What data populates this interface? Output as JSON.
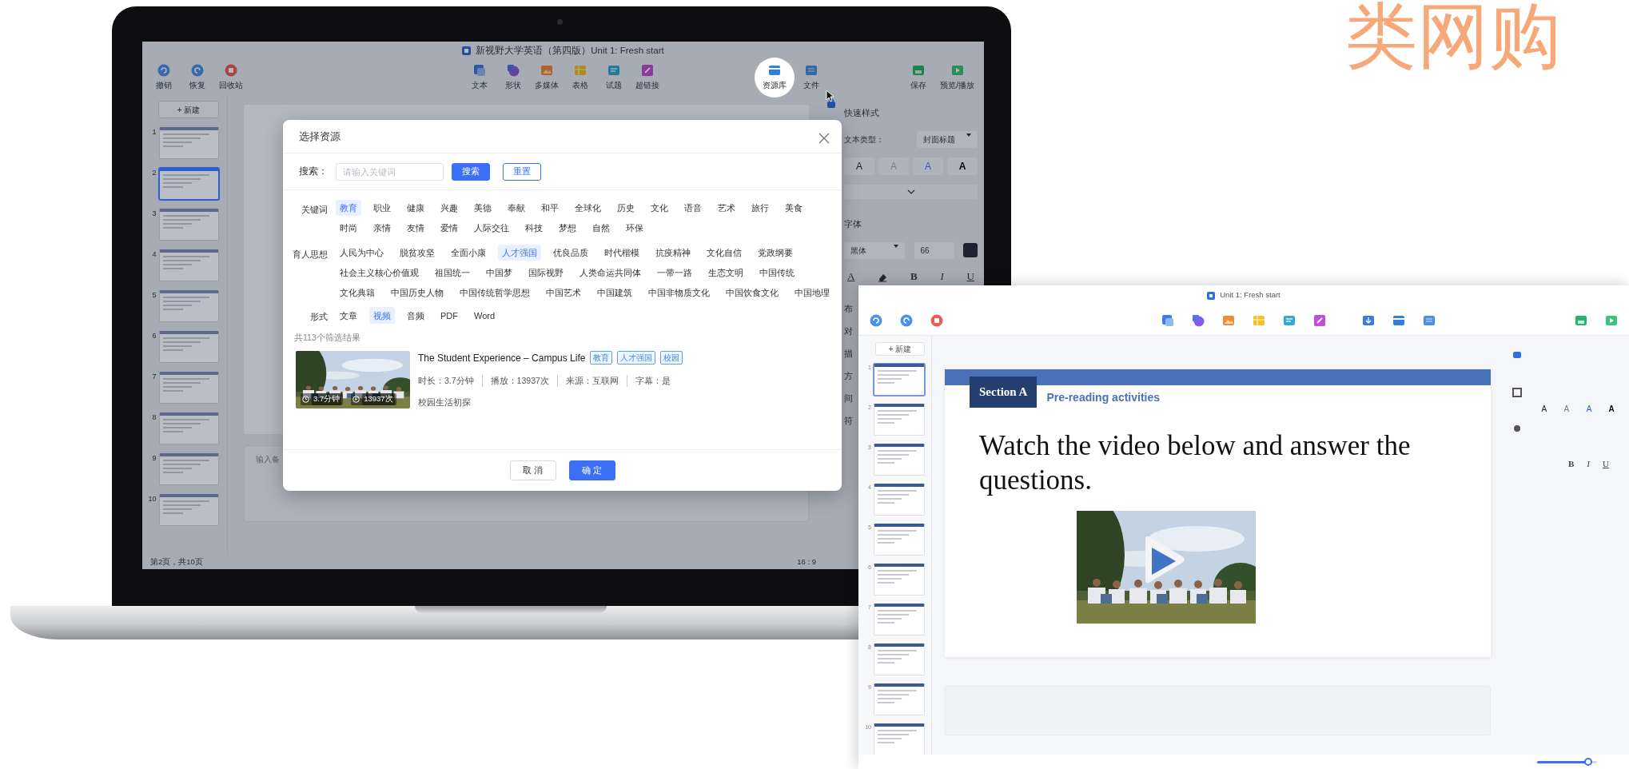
{
  "corner_text": "类网购",
  "laptop": {
    "title": "新视野大学英语（第四版）Unit 1: Fresh start",
    "toolbar_left": [
      {
        "kind": "undo",
        "label": "撤销"
      },
      {
        "kind": "redo",
        "label": "恢复"
      },
      {
        "kind": "trash",
        "label": "回收站"
      }
    ],
    "toolbar_center": [
      {
        "kind": "text",
        "label": "文本"
      },
      {
        "kind": "shape",
        "label": "形状"
      },
      {
        "kind": "media",
        "label": "多媒体"
      },
      {
        "kind": "table",
        "label": "表格"
      },
      {
        "kind": "quiz",
        "label": "试题"
      },
      {
        "kind": "link",
        "label": "超链接"
      }
    ],
    "toolbar_right": [
      {
        "kind": "library",
        "label": "资源库",
        "highlighted": true
      },
      {
        "kind": "file",
        "label": "文件",
        "highlighted": false
      }
    ],
    "toolbar_save": [
      {
        "kind": "save",
        "label": "保存"
      },
      {
        "kind": "preview",
        "label": "预览/播放"
      }
    ],
    "new_slide": "+ 新建",
    "slides": [
      {
        "number": "1",
        "selected": false
      },
      {
        "number": "2",
        "selected": true
      },
      {
        "number": "3",
        "selected": false
      },
      {
        "number": "4",
        "selected": false
      },
      {
        "number": "5",
        "selected": false
      },
      {
        "number": "6",
        "selected": false
      },
      {
        "number": "7",
        "selected": false
      },
      {
        "number": "8",
        "selected": false
      },
      {
        "number": "9",
        "selected": false
      },
      {
        "number": "10",
        "selected": false
      }
    ],
    "notes_placeholder": "输入备",
    "status": "第2页，共10页",
    "ratio": "16 : 9",
    "panel": {
      "title": "快速样式",
      "text_type_label": "文本类型：",
      "text_type": "封面标题",
      "style_samples": [
        {
          "text": "A",
          "kind": "plain"
        },
        {
          "text": "A",
          "kind": "faint"
        },
        {
          "text": "A",
          "kind": "accent"
        },
        {
          "text": "A",
          "kind": "bold"
        }
      ],
      "font_label": "字体",
      "font": "黑体",
      "font_size": "66",
      "format": [
        {
          "kind": "color",
          "text": "A"
        },
        {
          "kind": "eraser"
        },
        {
          "kind": "bold",
          "text": "B"
        },
        {
          "kind": "italic",
          "text": "I"
        },
        {
          "kind": "underline",
          "text": "U"
        }
      ],
      "cut_labels": [
        "布",
        "对",
        "描",
        "方",
        "间",
        "符"
      ]
    }
  },
  "dialog": {
    "title": "选择资源",
    "search_label": "搜索：",
    "placeholder": "请输入关键词",
    "search_buttons": [
      {
        "text": "搜索",
        "kind": "primary"
      },
      {
        "text": "重置",
        "kind": "outline"
      }
    ],
    "filters": [
      {
        "label": "关键词",
        "options": [
          {
            "text": "教育",
            "selected": true
          },
          {
            "text": "职业",
            "selected": false
          },
          {
            "text": "健康",
            "selected": false
          },
          {
            "text": "兴趣",
            "selected": false
          },
          {
            "text": "美德",
            "selected": false
          },
          {
            "text": "奉献",
            "selected": false
          },
          {
            "text": "和平",
            "selected": false
          },
          {
            "text": "全球化",
            "selected": false
          },
          {
            "text": "历史",
            "selected": false
          },
          {
            "text": "文化",
            "selected": false
          },
          {
            "text": "语音",
            "selected": false
          },
          {
            "text": "艺术",
            "selected": false
          },
          {
            "text": "旅行",
            "selected": false
          },
          {
            "text": "美食",
            "selected": false
          },
          {
            "text": "时尚",
            "selected": false
          },
          {
            "text": "亲情",
            "selected": false
          },
          {
            "text": "友情",
            "selected": false
          },
          {
            "text": "爱情",
            "selected": false
          },
          {
            "text": "人际交往",
            "selected": false
          },
          {
            "text": "科技",
            "selected": false
          },
          {
            "text": "梦想",
            "selected": false
          },
          {
            "text": "自然",
            "selected": false
          },
          {
            "text": "环保",
            "selected": false
          }
        ]
      },
      {
        "label": "育人思想",
        "options": [
          {
            "text": "人民为中心",
            "selected": false
          },
          {
            "text": "脱贫攻坚",
            "selected": false
          },
          {
            "text": "全面小康",
            "selected": false
          },
          {
            "text": "人才强国",
            "selected": true
          },
          {
            "text": "优良品质",
            "selected": false
          },
          {
            "text": "时代楷模",
            "selected": false
          },
          {
            "text": "抗疫精神",
            "selected": false
          },
          {
            "text": "文化自信",
            "selected": false
          },
          {
            "text": "党政纲要",
            "selected": false
          },
          {
            "text": "社会主义核心价值观",
            "selected": false
          },
          {
            "text": "祖国统一",
            "selected": false
          },
          {
            "text": "中国梦",
            "selected": false
          },
          {
            "text": "国际视野",
            "selected": false
          },
          {
            "text": "人类命运共同体",
            "selected": false
          },
          {
            "text": "一带一路",
            "selected": false
          },
          {
            "text": "生态文明",
            "selected": false
          },
          {
            "text": "中国传统",
            "selected": false
          },
          {
            "text": "文化典籍",
            "selected": false
          },
          {
            "text": "中国历史人物",
            "selected": false
          },
          {
            "text": "中国传统哲学思想",
            "selected": false
          },
          {
            "text": "中国艺术",
            "selected": false
          },
          {
            "text": "中国建筑",
            "selected": false
          },
          {
            "text": "中国非物质文化",
            "selected": false
          },
          {
            "text": "中国饮食文化",
            "selected": false
          },
          {
            "text": "中国地理",
            "selected": false
          }
        ]
      },
      {
        "label": "形式",
        "options": [
          {
            "text": "文章",
            "selected": false
          },
          {
            "text": "视频",
            "selected": true
          },
          {
            "text": "音频",
            "selected": false
          },
          {
            "text": "PDF",
            "selected": false
          },
          {
            "text": "Word",
            "selected": false
          }
        ]
      }
    ],
    "result_count": "共113个筛选结果",
    "results": [
      {
        "title": "The Student Experience – Campus Life",
        "tags": [
          "教育",
          "人才强国",
          "校园"
        ],
        "meta": [
          "时长：3.7分钟",
          "播放：13937次",
          "来源：互联网",
          "字幕：是"
        ],
        "description": "校园生活初探",
        "duration": "3.7分钟",
        "plays": "13937次"
      }
    ],
    "footer_buttons": [
      {
        "text": "取 消",
        "kind": "secondary"
      },
      {
        "text": "确 定",
        "kind": "primary"
      }
    ]
  },
  "window2": {
    "title": "Unit 1: Fresh start",
    "toolbar_left": [
      {
        "kind": "undo"
      },
      {
        "kind": "redo"
      },
      {
        "kind": "trash"
      }
    ],
    "toolbar_center": [
      {
        "kind": "text"
      },
      {
        "kind": "shape"
      },
      {
        "kind": "media"
      },
      {
        "kind": "table"
      },
      {
        "kind": "quiz"
      },
      {
        "kind": "link"
      }
    ],
    "toolbar_right": [
      {
        "kind": "import"
      },
      {
        "kind": "library"
      },
      {
        "kind": "file"
      }
    ],
    "toolbar_save": [
      {
        "kind": "save"
      },
      {
        "kind": "preview"
      }
    ],
    "new_slide": "+ 新建",
    "slides": [
      {
        "number": "1",
        "selected": true
      },
      {
        "number": "2",
        "selected": false
      },
      {
        "number": "3",
        "selected": false
      },
      {
        "number": "4",
        "selected": false
      },
      {
        "number": "5",
        "selected": false
      },
      {
        "number": "6",
        "selected": false
      },
      {
        "number": "7",
        "selected": false
      },
      {
        "number": "8",
        "selected": false
      },
      {
        "number": "9",
        "selected": false
      },
      {
        "number": "10",
        "selected": false
      }
    ],
    "section": "Section A",
    "subtitle": "Pre-reading activities",
    "instruction": "Watch the video below and answer the questions.",
    "side_tabs": [
      {
        "kind": "style",
        "selected": true
      },
      {
        "kind": "layout",
        "selected": false
      },
      {
        "kind": "animation",
        "selected": false
      }
    ],
    "style_samples": [
      {
        "text": "A",
        "kind": "plain"
      },
      {
        "text": "A",
        "kind": "faint"
      },
      {
        "text": "A",
        "kind": "accent"
      },
      {
        "text": "A",
        "kind": "bold"
      }
    ],
    "format": [
      {
        "kind": "bold",
        "text": "B"
      },
      {
        "kind": "italic",
        "text": "I"
      },
      {
        "kind": "underline",
        "text": "U"
      }
    ],
    "zoom": {
      "level": 0.85
    }
  }
}
